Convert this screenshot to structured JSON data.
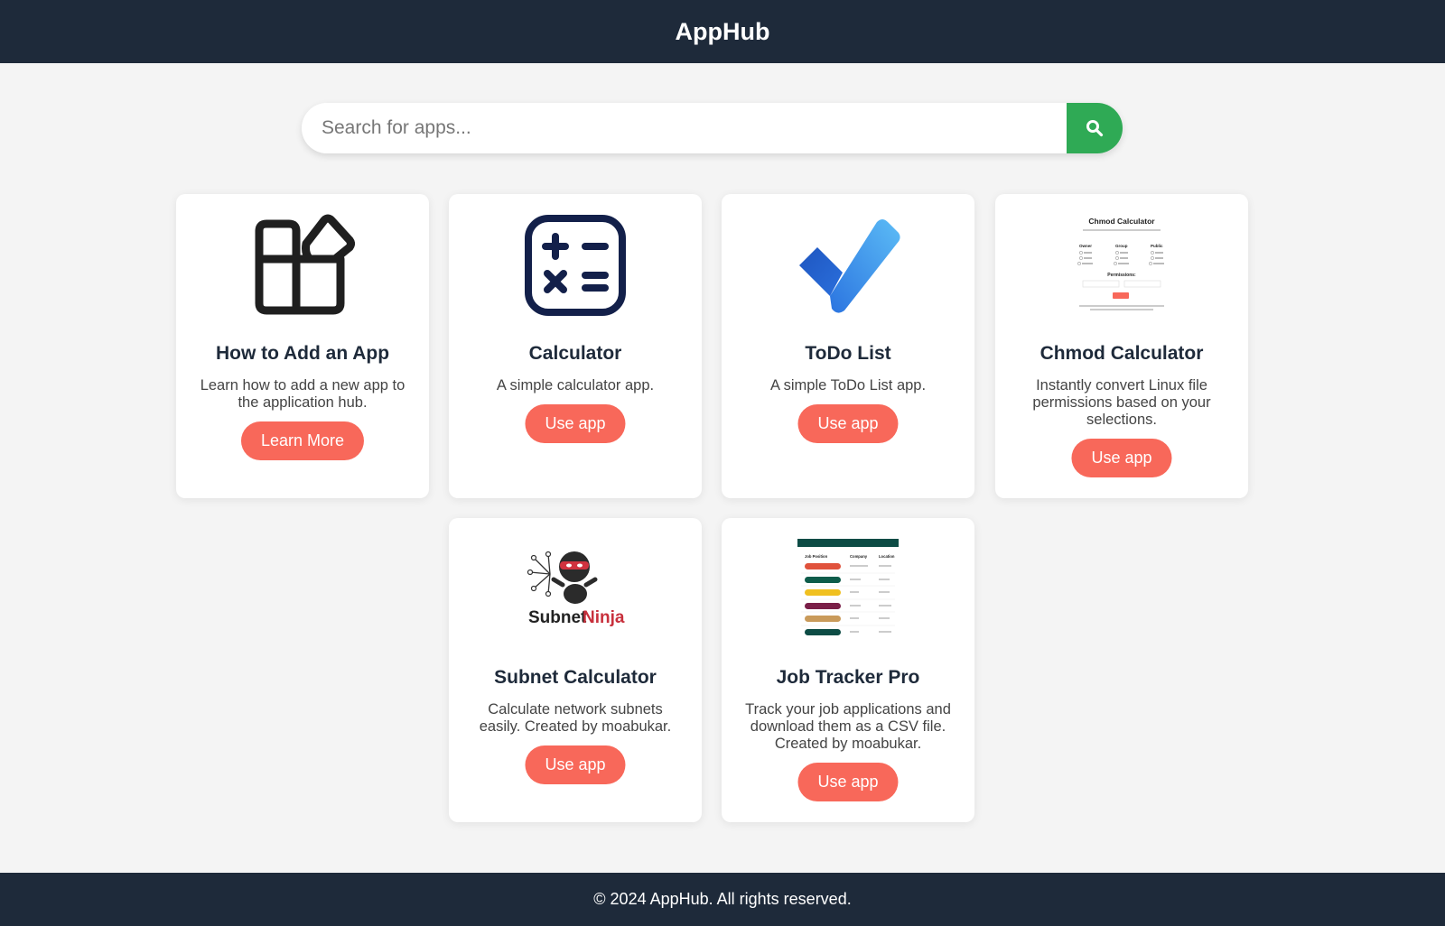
{
  "header": {
    "title": "AppHub"
  },
  "search": {
    "placeholder": "Search for apps...",
    "value": ""
  },
  "cards": [
    {
      "title": "How to Add an App",
      "description": "Learn how to add a new app to the application hub.",
      "button": "Learn More",
      "icon": "apps-icon"
    },
    {
      "title": "Calculator",
      "description": "A simple calculator app.",
      "button": "Use app",
      "icon": "calculator-icon"
    },
    {
      "title": "ToDo List",
      "description": "A simple ToDo List app.",
      "button": "Use app",
      "icon": "checkmark-icon"
    },
    {
      "title": "Chmod Calculator",
      "description": "Instantly convert Linux file permissions based on your selections.",
      "button": "Use app",
      "icon": "chmod-preview"
    },
    {
      "title": "Subnet Calculator",
      "description": "Calculate network subnets easily. Created by moabukar.",
      "button": "Use app",
      "icon": "subnet-ninja-logo"
    },
    {
      "title": "Job Tracker Pro",
      "description": "Track your job applications and download them as a CSV file. Created by moabukar.",
      "button": "Use app",
      "icon": "job-tracker-preview"
    }
  ],
  "chmod_preview": {
    "title": "Chmod Calculator",
    "groups": [
      "Owner",
      "Group",
      "Public"
    ],
    "permissions_label": "Permissions:",
    "subnet_logo_text_1": "Subnet",
    "subnet_logo_text_2": "Ninja"
  },
  "job_preview": {
    "headers": [
      "Job Position",
      "Company",
      "Location"
    ]
  },
  "footer": {
    "text": "© 2024 AppHub. All rights reserved."
  },
  "colors": {
    "header": "#1e2a3a",
    "accent": "#f8685a",
    "search_button": "#2faa55"
  }
}
